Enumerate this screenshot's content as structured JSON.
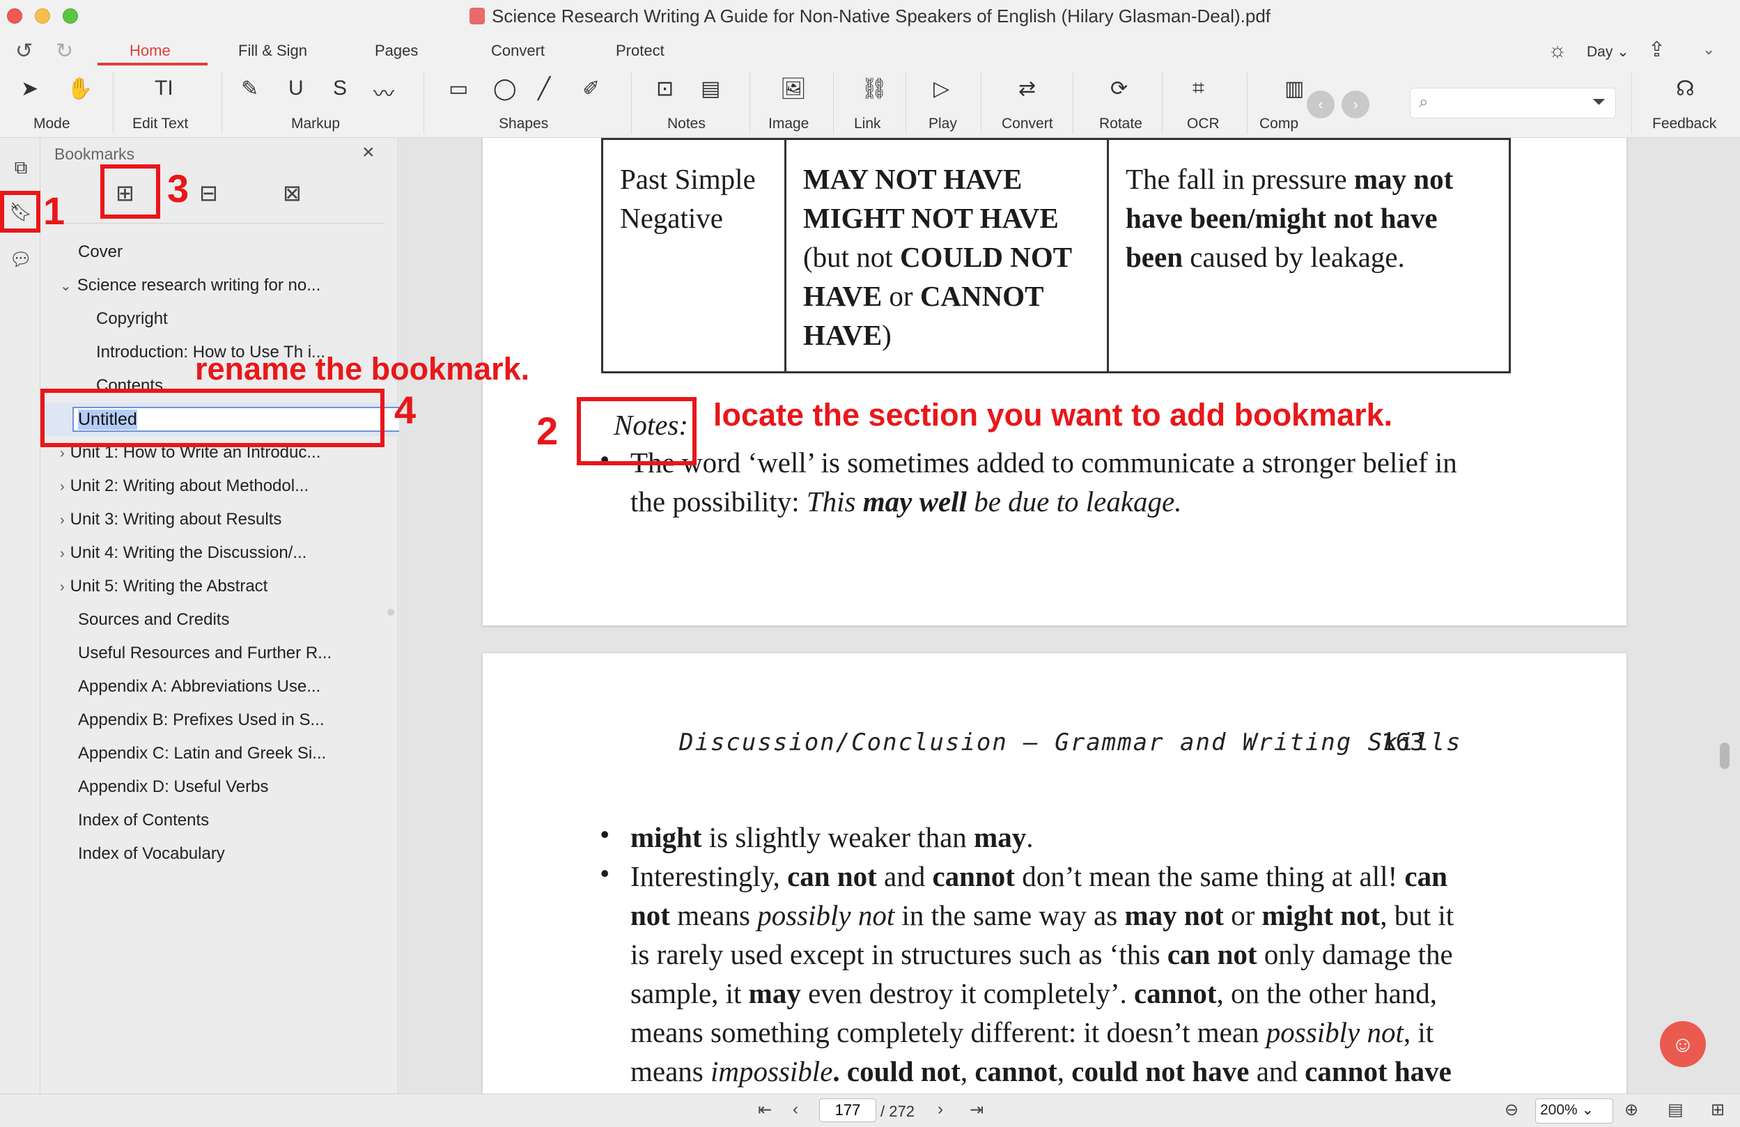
{
  "window": {
    "title": "Science Research Writing A Guide for Non-Native Speakers of English (Hilary Glasman-Deal).pdf"
  },
  "menu": {
    "tabs": [
      "Home",
      "Fill & Sign",
      "Pages",
      "Convert",
      "Protect"
    ],
    "active_tab": "Home",
    "theme_label": "Day"
  },
  "toolbar": {
    "mode": "Mode",
    "edit_text": "Edit Text",
    "markup": "Markup",
    "shapes": "Shapes",
    "notes": "Notes",
    "image": "Image",
    "link": "Link",
    "play": "Play",
    "convert": "Convert",
    "rotate": "Rotate",
    "ocr": "OCR",
    "compress": "Comp",
    "feedback": "Feedback",
    "search_placeholder": ""
  },
  "bookmarks": {
    "title": "Bookmarks",
    "items": [
      {
        "label": "Cover",
        "level": 0,
        "caret": ""
      },
      {
        "label": "Science research writing for no...",
        "level": 0,
        "caret": "expanded"
      },
      {
        "label": "Copyright",
        "level": 1,
        "caret": ""
      },
      {
        "label": "Introduction: How to Use Th i...",
        "level": 1,
        "caret": ""
      },
      {
        "label": "Contents",
        "level": 1,
        "caret": ""
      },
      {
        "label": "Unit 1: How to Write an Introduc...",
        "level": 0,
        "caret": "collapsed"
      },
      {
        "label": "Unit 2: Writing about Methodol...",
        "level": 0,
        "caret": "collapsed"
      },
      {
        "label": "Unit 3: Writing about Results",
        "level": 0,
        "caret": "collapsed"
      },
      {
        "label": "Unit 4: Writing the Discussion/...",
        "level": 0,
        "caret": "collapsed"
      },
      {
        "label": "Unit 5: Writing the Abstract",
        "level": 0,
        "caret": "collapsed"
      },
      {
        "label": "Sources and Credits",
        "level": 0,
        "caret": ""
      },
      {
        "label": "Useful Resources and Further R...",
        "level": 0,
        "caret": ""
      },
      {
        "label": "Appendix A: Abbreviations Use...",
        "level": 0,
        "caret": ""
      },
      {
        "label": "Appendix B: Prefixes Used in S...",
        "level": 0,
        "caret": ""
      },
      {
        "label": "Appendix C: Latin and Greek Si...",
        "level": 0,
        "caret": ""
      },
      {
        "label": "Appendix D: Useful Verbs",
        "level": 0,
        "caret": ""
      },
      {
        "label": "Index of Contents",
        "level": 0,
        "caret": ""
      },
      {
        "label": "Index of Vocabulary",
        "level": 0,
        "caret": ""
      }
    ],
    "rename_value": "Untitled"
  },
  "document": {
    "table_row": {
      "col1_a": "Past Simple",
      "col1_b": "Negative",
      "col2_l1": "MAY NOT HAVE",
      "col2_l2": "MIGHT NOT HAVE",
      "col2_l3a": "(but not ",
      "col2_l3b": "COULD NOT",
      "col2_l4a": "HAVE",
      "col2_l4b": " or ",
      "col2_l4c": "CANNOT",
      "col2_l5a": "HAVE",
      "col2_l5b": ")",
      "col3_a": "The fall in pressure ",
      "col3_b": "may not have been/might not have been",
      "col3_c": " caused by leakage."
    },
    "notes_label": "Notes:",
    "note_bullet": {
      "text1": "The word ‘well’ is sometimes added to communicate a stronger belief in",
      "text2a": "the possibility: ",
      "text2b": "This ",
      "text2c": "may well",
      "text2d": " be due to leakage."
    },
    "running_head": "Discussion/Conclusion — Grammar and Writing Skills",
    "page_number": "163",
    "bullet1": {
      "b1": "might",
      "t1": " is slightly weaker than ",
      "b2": "may",
      "t2": "."
    },
    "bullet2": {
      "l1a": "Interestingly, ",
      "l1b": "can not",
      "l1c": " and ",
      "l1d": "cannot",
      "l1e": " don’t mean the same thing at all! ",
      "l1f": "can",
      "l2a": "not",
      "l2b": " means ",
      "l2c": "possibly not",
      "l2d": " in the same way as ",
      "l2e": "may not",
      "l2f": " or ",
      "l2g": "might not",
      "l2h": ", but it",
      "l3a": "is rarely used except in structures such as ‘this ",
      "l3b": "can not",
      "l3c": " only damage the",
      "l4a": "sample, it ",
      "l4b": "may",
      "l4c": " even destroy it completely’. ",
      "l4d": "cannot",
      "l4e": ", on the other hand,",
      "l5a": "means something completely different: it doesn’t mean ",
      "l5b": "possibly not",
      "l5c": ", it",
      "l6a": "means ",
      "l6b": "impossible",
      "l6c": ". ",
      "l6d": "could not",
      "l6e": ", ",
      "l6f": "cannot",
      "l6g": ", ",
      "l6h": "could not have",
      "l6i": " and ",
      "l6j": "cannot have"
    }
  },
  "navigation": {
    "current_page": "177",
    "total_pages": "/ 272",
    "zoom": "200%"
  },
  "annotations": {
    "step1": "1",
    "step2": "2",
    "step3": "3",
    "step4": "4",
    "locate_text": "locate the section you want to add bookmark.",
    "rename_text": "rename the bookmark."
  },
  "colors": {
    "accent": "#e0403a",
    "annotation": "#e8171a",
    "selection_border": "#6f93d9"
  }
}
